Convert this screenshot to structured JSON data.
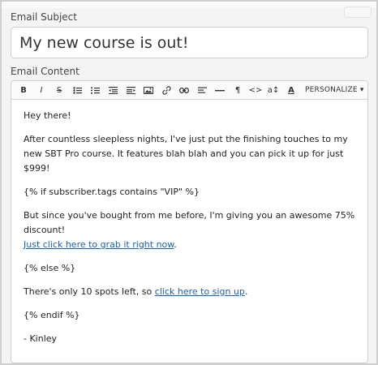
{
  "subject": {
    "label": "Email Subject",
    "value": "My new course is out!"
  },
  "content": {
    "label": "Email Content",
    "toolbar": {
      "buttons": [
        {
          "name": "bold-button",
          "glyph": "B"
        },
        {
          "name": "italic-button",
          "glyph": "I"
        },
        {
          "name": "strikethrough-button",
          "glyph": "S"
        },
        {
          "name": "bulleted-list-icon",
          "glyph": ""
        },
        {
          "name": "numbered-list-icon",
          "glyph": ""
        },
        {
          "name": "outdent-icon",
          "glyph": ""
        },
        {
          "name": "indent-icon",
          "glyph": ""
        },
        {
          "name": "image-icon",
          "glyph": ""
        },
        {
          "name": "link-icon",
          "glyph": ""
        },
        {
          "name": "unlink-icon",
          "glyph": ""
        },
        {
          "name": "align-icon",
          "glyph": ""
        },
        {
          "name": "horizontal-rule-icon",
          "glyph": ""
        },
        {
          "name": "paragraph-icon",
          "glyph": "¶"
        },
        {
          "name": "code-icon",
          "glyph": "<>"
        },
        {
          "name": "font-size-icon",
          "glyph": "a↕"
        },
        {
          "name": "font-color-icon",
          "glyph": "A"
        }
      ],
      "personalize": "PERSONALIZE ▾"
    },
    "body": {
      "greeting": "Hey there!",
      "intro": "After countless sleepless nights, I've just put the finishing touches to my new SBT Pro course.  It features blah blah and you can pick it up for just $999!",
      "if_tag": "{% if subscriber.tags contains \"VIP\" %}",
      "vip_text": "But since you've bought from me before, I'm giving you an awesome 75% discount!",
      "vip_link": "Just click here to grab it right now",
      "else_tag": "{% else %}",
      "spots_text": "There's only 10 spots left, so ",
      "spots_link": "click here to sign up",
      "period": ".",
      "endif_tag": "{% endif %}",
      "signature": "- Kinley"
    }
  },
  "colors": {
    "link": "#1a5fb4",
    "border": "#cfcfcf"
  }
}
